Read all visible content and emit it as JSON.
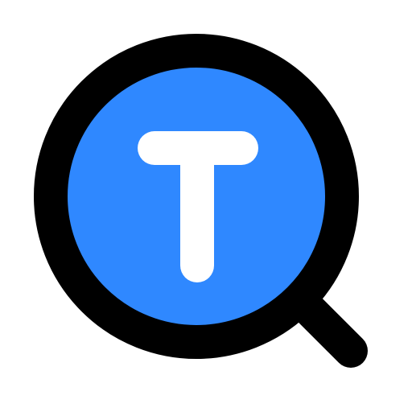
{
  "icon": {
    "name": "text-search-icon",
    "colors": {
      "fill": "#2F88FF",
      "outline": "#000000",
      "glyph": "#FFFFFF",
      "background": "#FFFFFF"
    }
  }
}
